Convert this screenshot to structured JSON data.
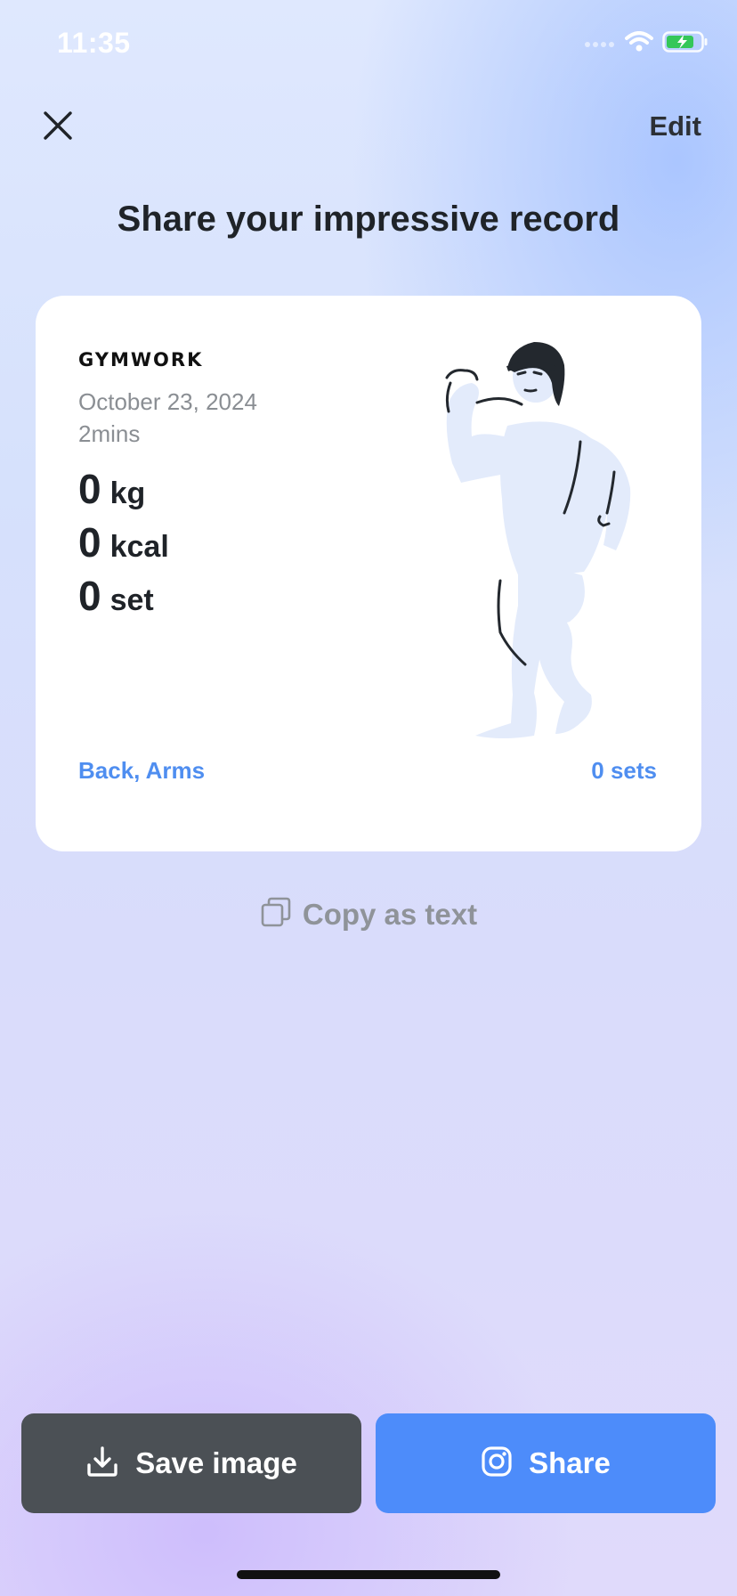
{
  "status_bar": {
    "time": "11:35",
    "icons": [
      "signal-icon",
      "wifi-icon",
      "battery-charging-icon"
    ],
    "battery_color": "#34c759"
  },
  "header": {
    "close_icon": "close-icon",
    "edit_label": "Edit"
  },
  "page_title": "Share your impressive record",
  "card": {
    "brand": "GYMWORK",
    "date": "October 23, 2024",
    "duration": "2mins",
    "stats": [
      {
        "value": "0",
        "unit": "kg"
      },
      {
        "value": "0",
        "unit": "kcal"
      },
      {
        "value": "0",
        "unit": "set"
      }
    ],
    "illustration": "flexing-bodybuilder-illustration",
    "muscles": "Back, Arms",
    "sets": "0 sets",
    "accent_color": "#4f8ef0"
  },
  "copy_action": {
    "label": "Copy as text",
    "icon": "copy-icon"
  },
  "actions": {
    "save": {
      "label": "Save image",
      "icon": "download-icon",
      "color": "#4b5055"
    },
    "share": {
      "label": "Share",
      "icon": "instagram-icon",
      "color": "#4d8cfa"
    }
  }
}
